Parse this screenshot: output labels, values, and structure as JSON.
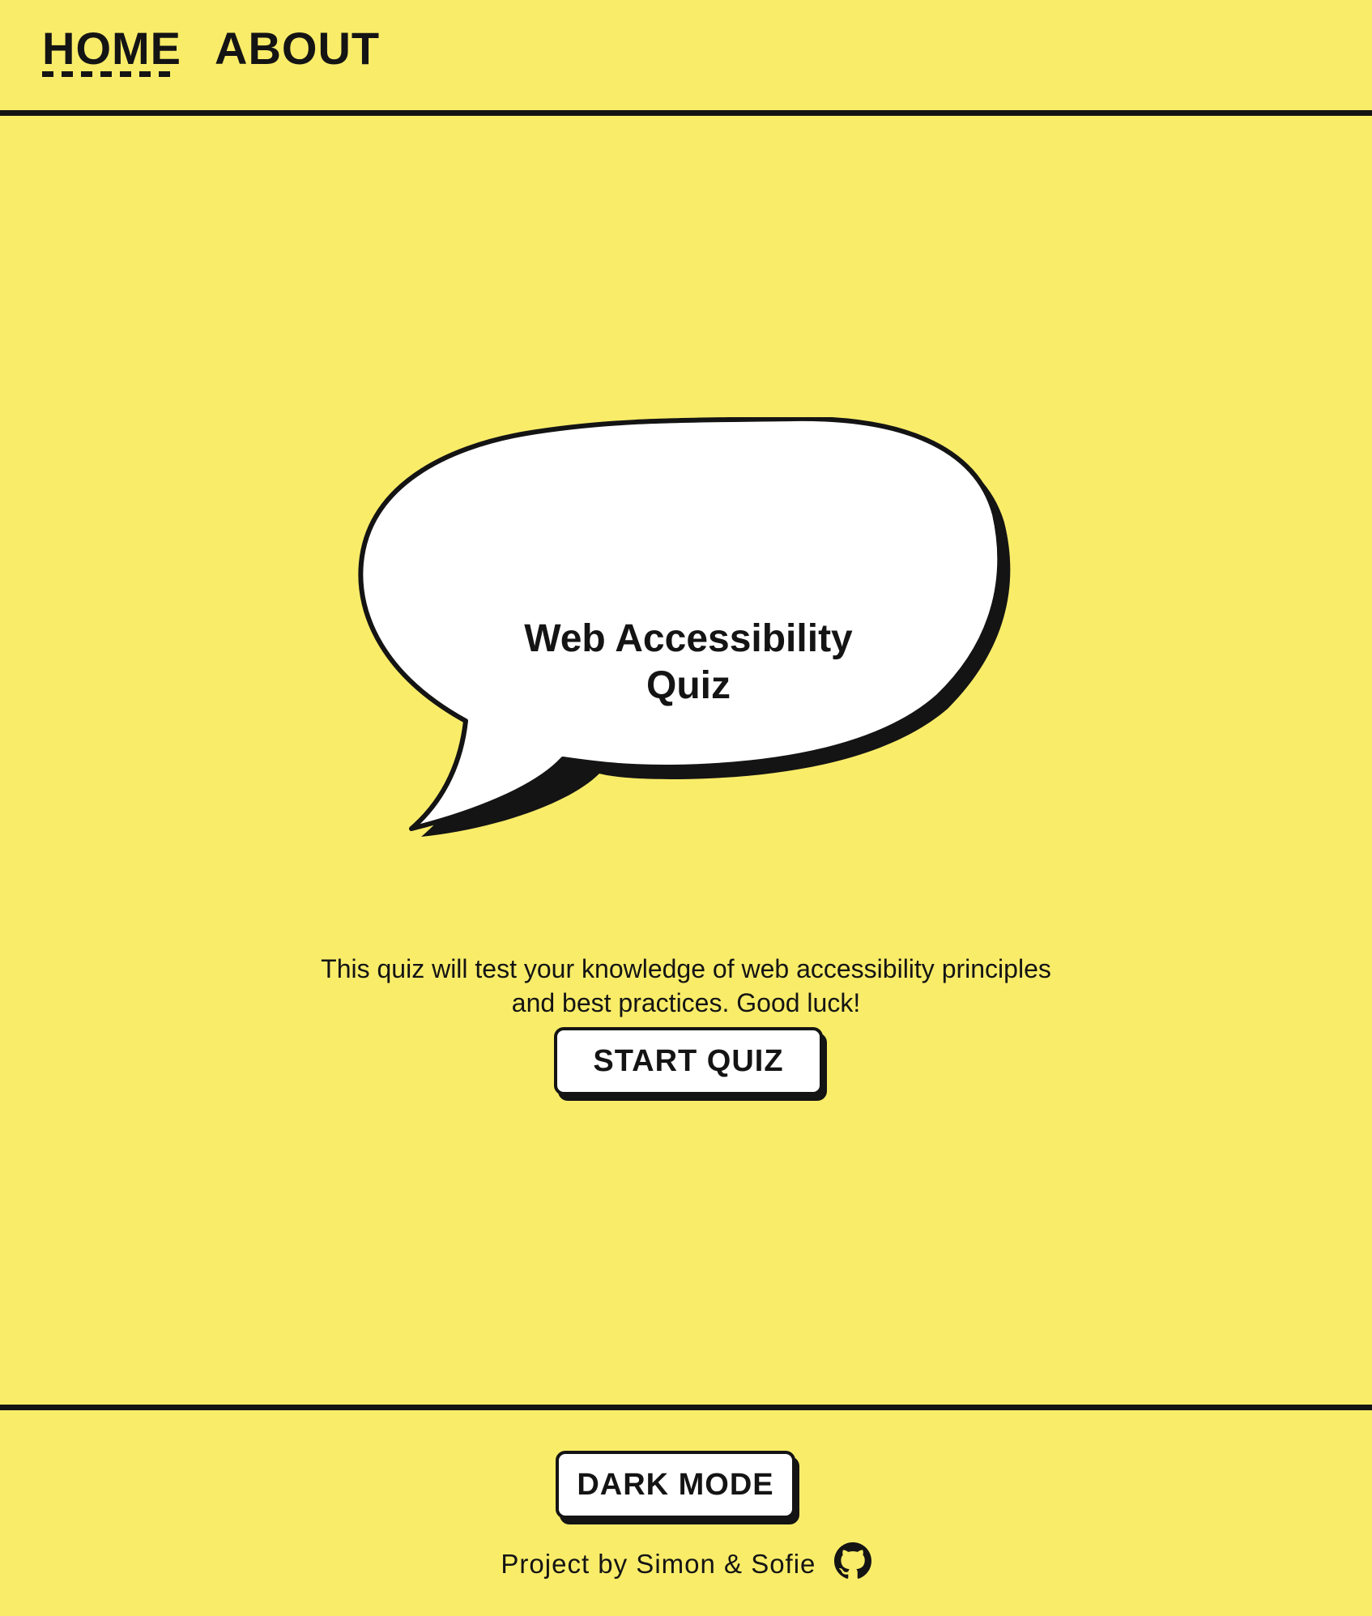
{
  "nav": {
    "home_label": "HOME",
    "about_label": "ABOUT"
  },
  "hero": {
    "title_line1": "Web Accessibility",
    "title_line2": "Quiz",
    "intro_line1": "This quiz will test your knowledge of web accessibility principles",
    "intro_line2": "and best practices. Good luck!",
    "start_label": "START QUIZ"
  },
  "footer": {
    "dark_mode_label": "DARK MODE",
    "credit": "Project by Simon & Sofie",
    "github_icon": "github-icon"
  },
  "colors": {
    "background": "#f9ec69",
    "ink": "#141414",
    "bubble": "#ffffff"
  }
}
